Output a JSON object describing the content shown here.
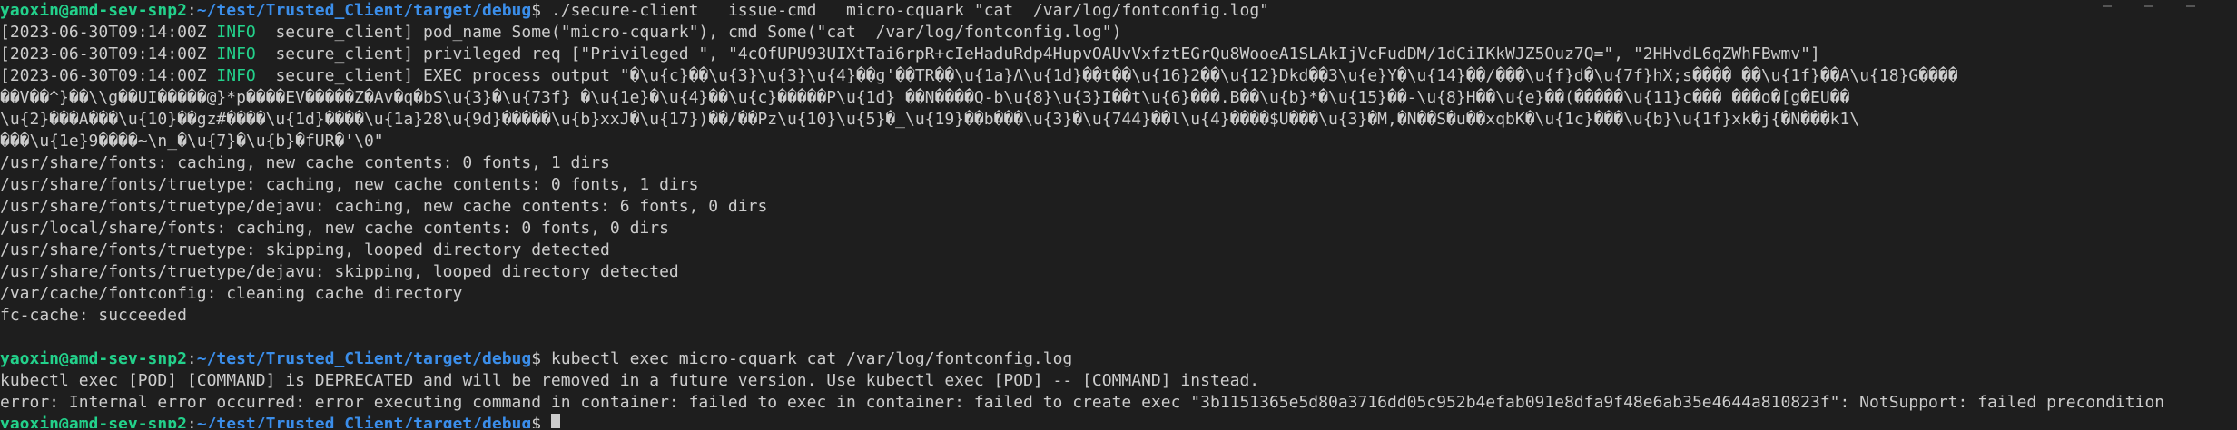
{
  "prompt": {
    "user_host": "yaoxin@amd-sev-snp2",
    "path": "~/test/Trusted_Client/target/debug",
    "symbol": "$"
  },
  "lines": [
    {
      "type": "prompt",
      "command": " ./secure-client   issue-cmd   micro-cquark \"cat  /var/log/fontconfig.log\""
    },
    {
      "type": "log",
      "time": "[2023-06-30T09:14:00Z ",
      "level": "INFO ",
      "message": " secure_client] pod_name Some(\"micro-cquark\"), cmd Some(\"cat  /var/log/fontconfig.log\")"
    },
    {
      "type": "log",
      "time": "[2023-06-30T09:14:00Z ",
      "level": "INFO ",
      "message": " secure_client] privileged req [\"Privileged \", \"4cOfUPU93UIXtTai6rpR+cIeHaduRdp4HupvOAUvVxfztEGrQu8WooeA1SLAkIjVcFudDM/1dCiIKkWJZ5Ouz7Q=\", \"2HHvdL6qZWhFBwmv\"]"
    },
    {
      "type": "log",
      "time": "[2023-06-30T09:14:00Z ",
      "level": "INFO ",
      "message": " secure_client] EXEC process output \"�\\u{c}��\\u{3}\\u{3}\\u{4}��g'��TR��\\u{1a}Λ\\u{1d}��t��\\u{16}2��\\u{12}Dkd��3\\u{e}Y�\\u{14}��/���\\u{f}d�\\u{7f}hX;s���� ��\\u{1f}��A\\u{18}G����"
    },
    {
      "type": "text",
      "text": "��V��^}��\\\\g��UI�����@}*p����EV�����Z�Av�q�bS\\u{3}�\\u{73f} �\\u{1e}�\\u{4}��\\u{c}�����P\\u{1d} ��N����Q-b\\u{8}\\u{3}I��t\\u{6}���.B��\\u{b}*�\\u{15}��-\\u{8}H��\\u{e}��(�����\\u{11}c��� ���o�[g�EU��"
    },
    {
      "type": "text",
      "text": "\\u{2}���A���\\u{10}��gz#����\\u{1d}����\\u{1a}28\\u{9d}�����\\u{b}xxJ�\\u{17})��/��Pz\\u{10}\\u{5}�_\\u{19}��b���\\u{3}�\\u{744}��l\\u{4}����$U���\\u{3}�M,�N��S�u��xqbK�\\u{1c}���\\u{b}\\u{1f}xk�j{�N���k1\\"
    },
    {
      "type": "text",
      "text": "���\\u{1e}9����~\\n_�\\u{7}�\\u{b}�fUR�'\\0\""
    },
    {
      "type": "text",
      "text": "/usr/share/fonts: caching, new cache contents: 0 fonts, 1 dirs"
    },
    {
      "type": "text",
      "text": "/usr/share/fonts/truetype: caching, new cache contents: 0 fonts, 1 dirs"
    },
    {
      "type": "text",
      "text": "/usr/share/fonts/truetype/dejavu: caching, new cache contents: 6 fonts, 0 dirs"
    },
    {
      "type": "text",
      "text": "/usr/local/share/fonts: caching, new cache contents: 0 fonts, 0 dirs"
    },
    {
      "type": "text",
      "text": "/usr/share/fonts/truetype: skipping, looped directory detected"
    },
    {
      "type": "text",
      "text": "/usr/share/fonts/truetype/dejavu: skipping, looped directory detected"
    },
    {
      "type": "text",
      "text": "/var/cache/fontconfig: cleaning cache directory"
    },
    {
      "type": "text",
      "text": "fc-cache: succeeded"
    },
    {
      "type": "blank"
    },
    {
      "type": "prompt",
      "command": " kubectl exec micro-cquark cat /var/log/fontconfig.log"
    },
    {
      "type": "text",
      "text": "kubectl exec [POD] [COMMAND] is DEPRECATED and will be removed in a future version. Use kubectl exec [POD] -- [COMMAND] instead."
    },
    {
      "type": "text",
      "text": "error: Internal error occurred: error executing command in container: failed to exec in container: failed to create exec \"3b1151365e5d80a3716dd05c952b4efab091e8dfa9f48e6ab35e4644a810823f\": NotSupport: failed precondition"
    },
    {
      "type": "prompt-cursor",
      "command": " "
    }
  ]
}
